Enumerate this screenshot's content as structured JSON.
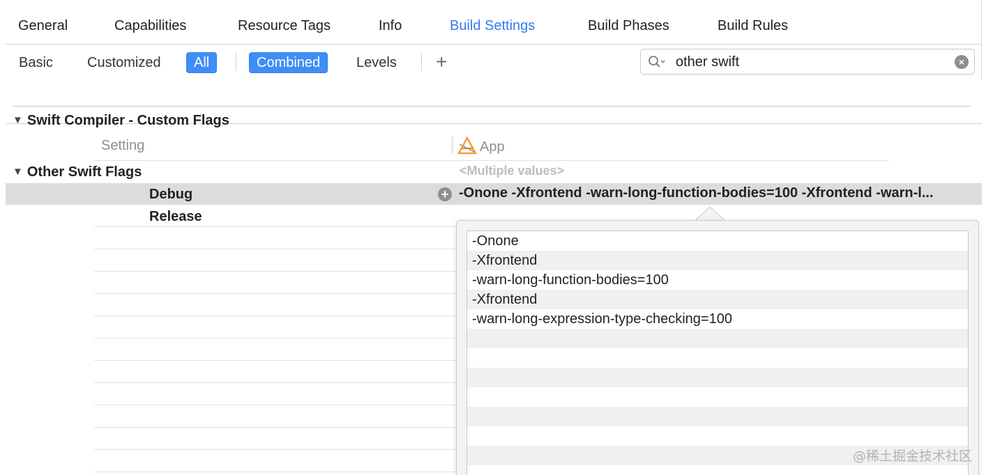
{
  "tabs": [
    {
      "label": "General",
      "active": false
    },
    {
      "label": "Capabilities",
      "active": false
    },
    {
      "label": "Resource Tags",
      "active": false
    },
    {
      "label": "Info",
      "active": false
    },
    {
      "label": "Build Settings",
      "active": true
    },
    {
      "label": "Build Phases",
      "active": false
    },
    {
      "label": "Build Rules",
      "active": false
    }
  ],
  "filters": {
    "basic": "Basic",
    "customized": "Customized",
    "all": "All",
    "combined": "Combined",
    "levels": "Levels",
    "add": "+",
    "selected_scope": "All",
    "selected_view": "Combined"
  },
  "search": {
    "value": "other swift"
  },
  "section": {
    "title": "Swift Compiler - Custom Flags",
    "column_setting": "Setting",
    "column_target": "App"
  },
  "setting": {
    "name": "Other Swift Flags",
    "summary": "<Multiple values>",
    "debug_label": "Debug",
    "debug_value": "-Onone -Xfrontend -warn-long-function-bodies=100 -Xfrontend -warn-l...",
    "release_label": "Release"
  },
  "popover": {
    "items": [
      "-Onone",
      "-Xfrontend",
      "-warn-long-function-bodies=100",
      "-Xfrontend",
      "-warn-long-expression-type-checking=100"
    ],
    "empty_rows": 8
  },
  "watermark": "@稀土掘金技术社区",
  "colors": {
    "accent": "#3478f6",
    "selected_button": "#3f8ef5",
    "selected_row": "#dcdcdc"
  }
}
